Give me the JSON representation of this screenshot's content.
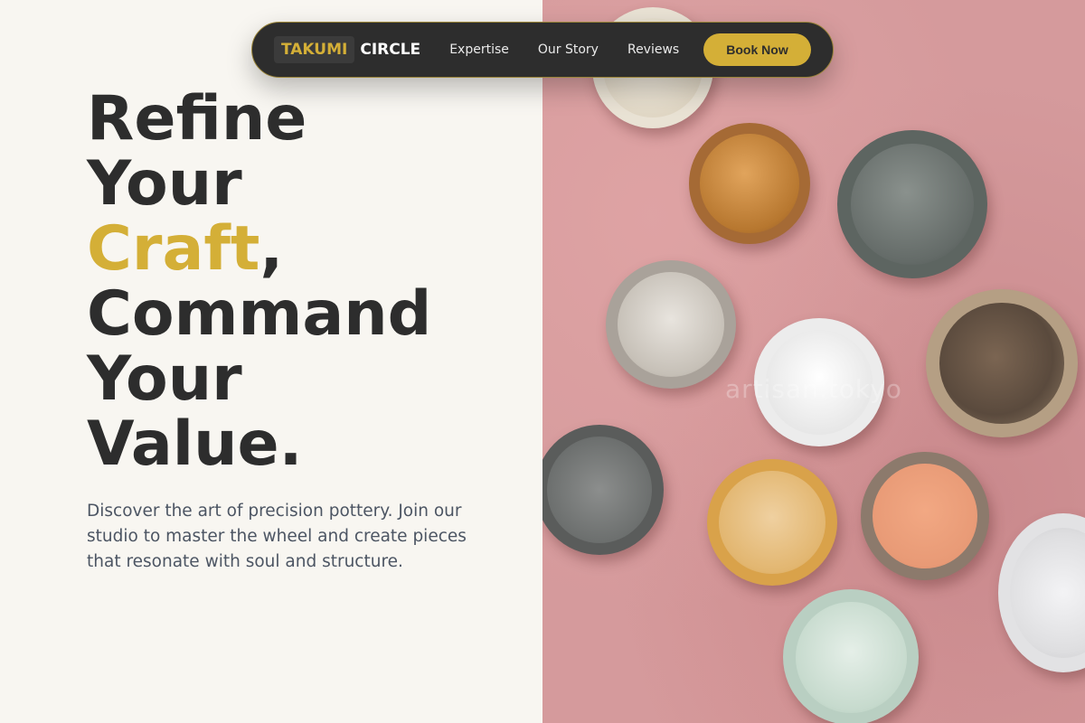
{
  "nav": {
    "logo_part1": "TAKUMI",
    "logo_part2": "CIRCLE",
    "links": [
      "Expertise",
      "Our Story",
      "Reviews"
    ],
    "cta": "Book Now"
  },
  "hero": {
    "line1": "Refine",
    "line2": "Your",
    "line3_accent": "Craft",
    "line3_rest": ",",
    "line4": "Command",
    "line5": "Your",
    "line6": "Value.",
    "tagline": "Discover the art of precision pottery. Join our studio to master the wheel and create pieces that resonate with soul and structure."
  },
  "image": {
    "watermark": "artisan.tokyo"
  },
  "colors": {
    "accent": "#d4af37",
    "dark": "#2d2d2d",
    "background": "#f8f6f1",
    "text_muted": "#4c5563"
  }
}
